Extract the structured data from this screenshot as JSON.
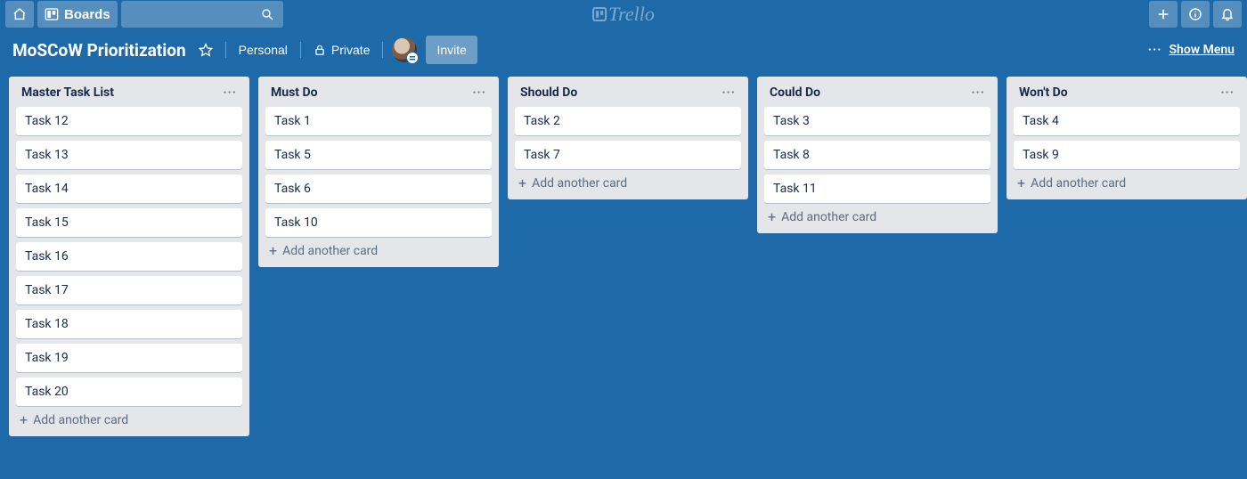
{
  "app": {
    "name": "Trello"
  },
  "global_header": {
    "boards_label": "Boards",
    "search_placeholder": ""
  },
  "board_header": {
    "title": "MoSCoW Prioritization",
    "visibility_team": "Personal",
    "visibility_scope": "Private",
    "invite_label": "Invite",
    "show_menu_label": "Show Menu",
    "ellipsis": "···"
  },
  "lists": [
    {
      "title": "Master Task List",
      "cards": [
        "Task 12",
        "Task 13",
        "Task 14",
        "Task 15",
        "Task 16",
        "Task 17",
        "Task 18",
        "Task 19",
        "Task 20"
      ],
      "add_label": "Add another card"
    },
    {
      "title": "Must Do",
      "cards": [
        "Task 1",
        "Task 5",
        "Task 6",
        "Task 10"
      ],
      "add_label": "Add another card"
    },
    {
      "title": "Should Do",
      "cards": [
        "Task 2",
        "Task 7"
      ],
      "add_label": "Add another card"
    },
    {
      "title": "Could Do",
      "cards": [
        "Task 3",
        "Task 8",
        "Task 11"
      ],
      "add_label": "Add another card"
    },
    {
      "title": "Won't Do",
      "cards": [
        "Task 4",
        "Task 9"
      ],
      "add_label": "Add another card"
    }
  ]
}
